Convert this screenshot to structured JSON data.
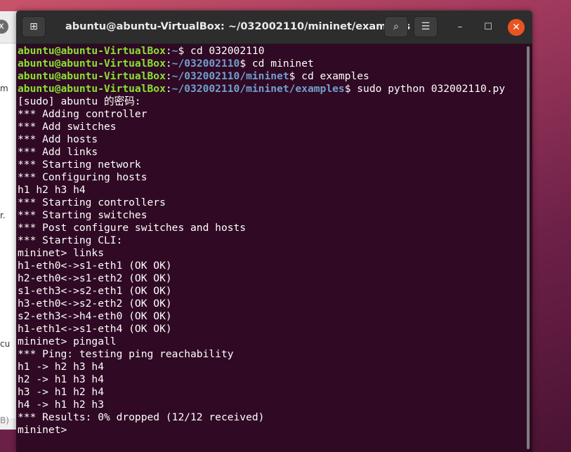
{
  "background_window": {
    "close_label": "x",
    "fragments": [
      "m",
      "r.",
      "cu",
      "B)"
    ]
  },
  "terminal": {
    "title": "abuntu@abuntu-VirtualBox: ~/032002110/mininet/examples",
    "new_tab_icon": "new-tab-icon",
    "icons": {
      "new_tab": "⊞",
      "search": "⌕",
      "menu": "☰",
      "minimize": "–",
      "maximize": "☐",
      "close": "✕"
    },
    "colors": {
      "background": "#300a24",
      "user": "#8ae234",
      "path": "#729fcf",
      "close_button": "#e95420"
    },
    "prompts": [
      {
        "user": "abuntu@abuntu-VirtualBox",
        "sep": ":",
        "path": "~",
        "command": "$ cd 032002110"
      },
      {
        "user": "abuntu@abuntu-VirtualBox",
        "sep": ":",
        "path": "~/032002110",
        "command": "$ cd mininet"
      },
      {
        "user": "abuntu@abuntu-VirtualBox",
        "sep": ":",
        "path": "~/032002110/mininet",
        "command": "$ cd examples"
      },
      {
        "user": "abuntu@abuntu-VirtualBox",
        "sep": ":",
        "path": "~/032002110/mininet/examples",
        "command": "$ sudo python 032002110.py"
      }
    ],
    "output": [
      "[sudo] abuntu 的密码:",
      "*** Adding controller",
      "*** Add switches",
      "*** Add hosts",
      "*** Add links",
      "*** Starting network",
      "*** Configuring hosts",
      "h1 h2 h3 h4",
      "*** Starting controllers",
      "*** Starting switches",
      "*** Post configure switches and hosts",
      "*** Starting CLI:",
      "mininet> links",
      "h1-eth0<->s1-eth1 (OK OK)",
      "h2-eth0<->s1-eth2 (OK OK)",
      "s1-eth3<->s2-eth1 (OK OK)",
      "h3-eth0<->s2-eth2 (OK OK)",
      "s2-eth3<->h4-eth0 (OK OK)",
      "h1-eth1<->s1-eth4 (OK OK)",
      "mininet> pingall",
      "*** Ping: testing ping reachability",
      "h1 -> h2 h3 h4",
      "h2 -> h1 h3 h4",
      "h3 -> h1 h2 h4",
      "h4 -> h1 h2 h3",
      "*** Results: 0% dropped (12/12 received)",
      "mininet> "
    ]
  }
}
